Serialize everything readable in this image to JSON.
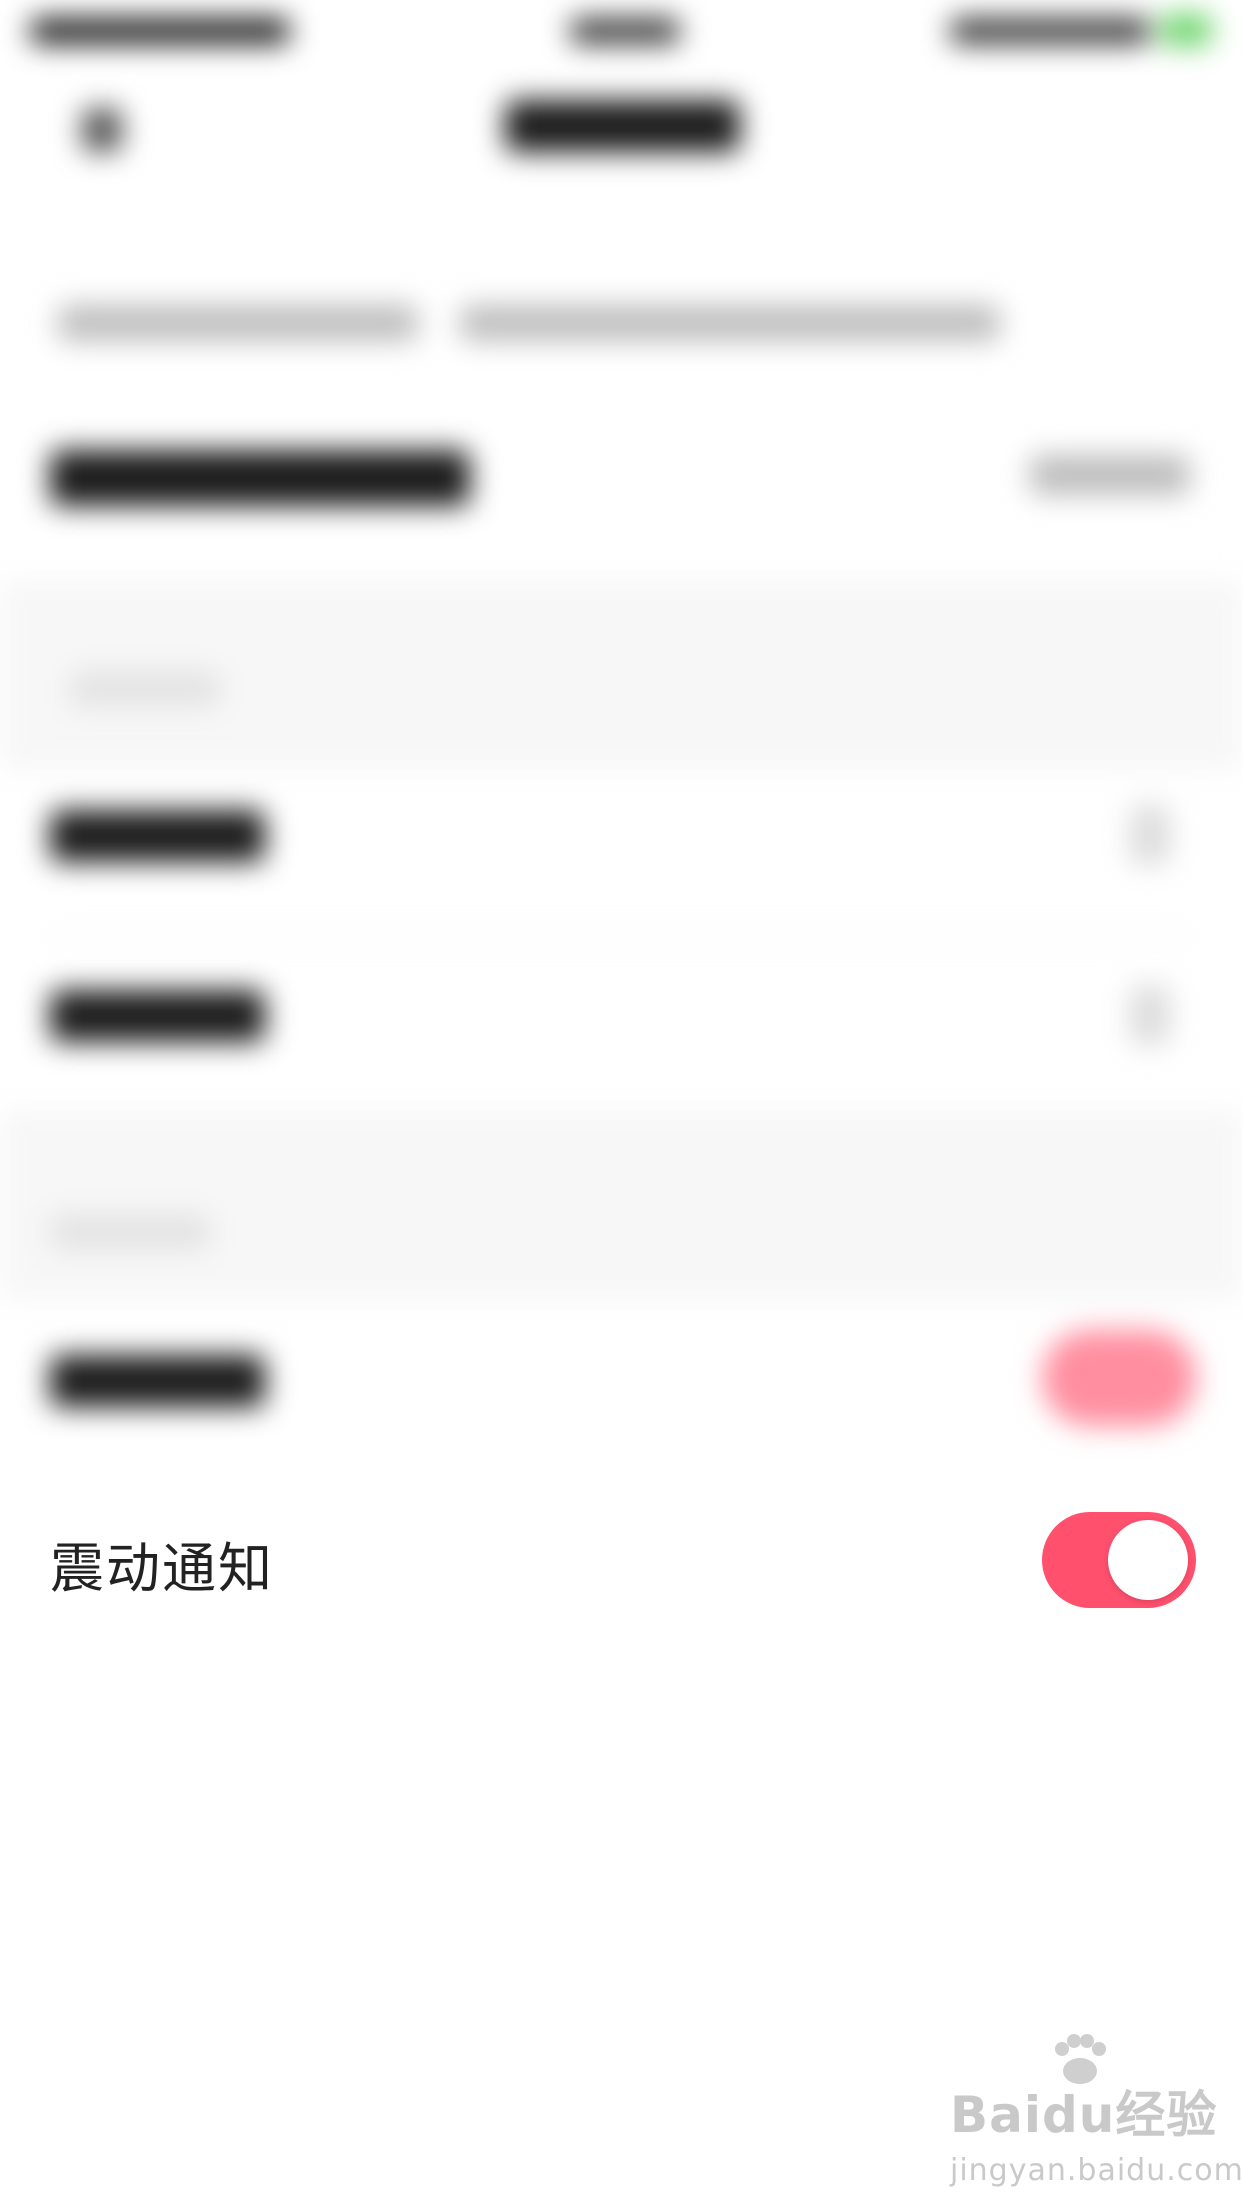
{
  "settings": {
    "vibrate_label": "震动通知",
    "vibrate_on": true
  },
  "colors": {
    "accent": "#ff506e",
    "text": "#222222",
    "background": "#ffffff"
  },
  "watermark": {
    "brand": "Baidu经验",
    "url": "jingyan.baidu.com"
  },
  "icons": [
    "back-arrow-icon",
    "chevron-right-icon",
    "baidu-paw-icon"
  ]
}
